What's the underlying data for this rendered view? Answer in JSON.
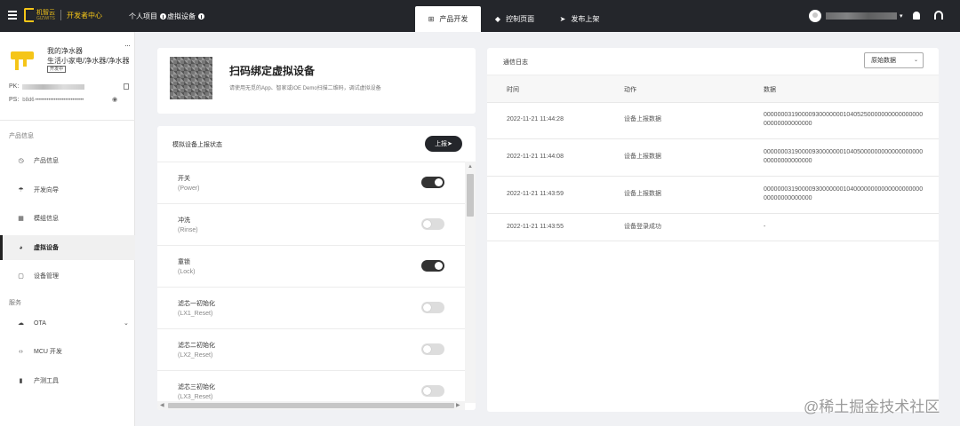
{
  "topbar": {
    "logo_cn": "机智云",
    "logo_en": "GIZWITS",
    "dev_center": "开发者中心",
    "crumb_personal": "个人项目",
    "crumb_virtual": "虚拟设备",
    "tabs": [
      {
        "label": "产品开发",
        "icon": "grid-icon",
        "active": true
      },
      {
        "label": "控制页面",
        "icon": "gem-icon",
        "active": false
      },
      {
        "label": "发布上架",
        "icon": "send-icon",
        "active": false
      }
    ],
    "caret": "▾"
  },
  "sidebar": {
    "product_name": "我的净水器",
    "product_category": "生活小家电/净水器/净水器",
    "product_tag": "开发中",
    "more": "···",
    "pk_label": "PK:",
    "ps_label": "PS:",
    "ps_prefix": "b8d6",
    "ps_mask": "••••••••••••••••••••••••••",
    "section_product": "产品信息",
    "section_service": "服务",
    "items": [
      {
        "label": "产品信息",
        "icon": "clock-icon"
      },
      {
        "label": "开发向导",
        "icon": "umbrella-icon"
      },
      {
        "label": "模组信息",
        "icon": "module-icon"
      },
      {
        "label": "虚拟设备",
        "icon": "virtual-device-icon"
      },
      {
        "label": "设备管理",
        "icon": "device-icon"
      },
      {
        "label": "OTA",
        "icon": "cloud-icon"
      },
      {
        "label": "MCU 开发",
        "icon": "code-icon"
      },
      {
        "label": "产测工具",
        "icon": "tool-icon"
      }
    ]
  },
  "scan": {
    "title": "扫码绑定虚拟设备",
    "desc": "请使用无觅的App、智家或IOE Demo扫描二维码，调试虚拟设备"
  },
  "report": {
    "title": "模拟设备上报状态",
    "button": "上报➤",
    "datapoints": [
      {
        "name": "开关",
        "code": "(Power)",
        "on": true
      },
      {
        "name": "冲洗",
        "code": "(Rinse)",
        "on": false
      },
      {
        "name": "童锁",
        "code": "(Lock)",
        "on": true
      },
      {
        "name": "滤芯一初始化",
        "code": "(LX1_Reset)",
        "on": false
      },
      {
        "name": "滤芯二初始化",
        "code": "(LX2_Reset)",
        "on": false
      },
      {
        "name": "滤芯三初始化",
        "code": "(LX3_Reset)",
        "on": false
      }
    ]
  },
  "log": {
    "title": "通信日志",
    "select_value": "原始数据",
    "columns": [
      "时间",
      "动作",
      "数据"
    ],
    "rows": [
      {
        "time": "2022-11-21 11:44:28",
        "action": "设备上报数据",
        "data": "000000031900009300000001040525000000000000000000000000000000"
      },
      {
        "time": "2022-11-21 11:44:08",
        "action": "设备上报数据",
        "data": "000000031900009300000001040500000000000000000000000000000000"
      },
      {
        "time": "2022-11-21 11:43:59",
        "action": "设备上报数据",
        "data": "000000031900009300000001040000000000000000000000000000000000"
      },
      {
        "time": "2022-11-21 11:43:55",
        "action": "设备登录成功",
        "data": "-"
      }
    ]
  },
  "watermark": "@稀土掘金技术社区"
}
